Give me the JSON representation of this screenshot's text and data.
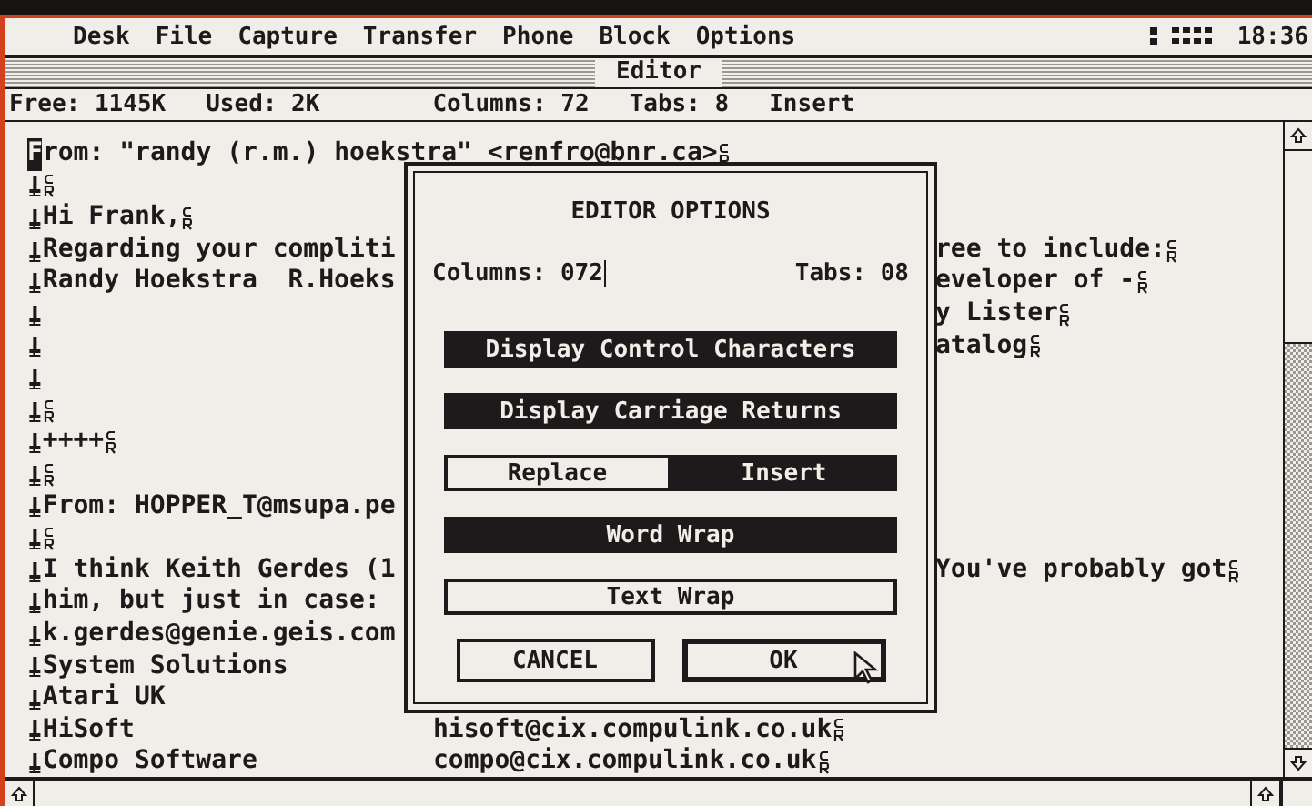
{
  "menu_bar": {
    "items": [
      "Desk",
      "File",
      "Capture",
      "Transfer",
      "Phone",
      "Block",
      "Options"
    ],
    "clock": "18:36"
  },
  "window": {
    "title": "Editor"
  },
  "status_line": {
    "free": "Free: 1145K",
    "used": "Used: 2K",
    "columns": "Columns: 72",
    "tabs": "Tabs: 8",
    "mode": "Insert"
  },
  "editor": {
    "lines": [
      {
        "cursor": "F",
        "left": "rom: \"randy (r.m.) hoekstra\" <renfro@bnr.ca>",
        "cr": true
      },
      {
        "tab": true,
        "cr": true
      },
      {
        "tab": true,
        "left": "Hi Frank,",
        "cr": true
      },
      {
        "tab": true,
        "left": "Regarding your compliti",
        "right": "ree to include:",
        "cr": true
      },
      {
        "tab": true,
        "left": "Randy Hoekstra  R.Hoeks",
        "right": "eveloper of -",
        "cr": true
      },
      {
        "tab": true,
        "right": "y Lister",
        "cr": true
      },
      {
        "tab": true,
        "right": "atalog",
        "cr": true
      },
      {
        "tab": true
      },
      {
        "tab": true,
        "cr": true
      },
      {
        "tab": true,
        "left": "++++",
        "cr": true
      },
      {
        "tab": true,
        "cr": true
      },
      {
        "tab": true,
        "left": "From: HOPPER_T@msupa.pe"
      },
      {
        "tab": true,
        "cr": true
      },
      {
        "tab": true,
        "left": "I think Keith Gerdes (1",
        "right": "You've probably got",
        "cr": true
      },
      {
        "tab": true,
        "left": "him, but just in case:"
      },
      {
        "tab": true,
        "left": "k.gerdes@genie.geis.com"
      },
      {
        "tab": true,
        "left": "System Solutions"
      },
      {
        "tab": true,
        "left": "Atari UK"
      },
      {
        "tab": true,
        "left": "HiSoft",
        "right": "hisoft@cix.compulink.co.uk",
        "cr": true
      },
      {
        "tab": true,
        "left": "Compo Software",
        "right": "compo@cix.compulink.co.uk",
        "cr": true
      }
    ]
  },
  "dialog": {
    "title": "EDITOR OPTIONS",
    "columns_label": "Columns:",
    "columns_value": "072",
    "tabs_label": "Tabs:",
    "tabs_value": "08",
    "options": [
      {
        "kind": "toggle",
        "label": "Display Control Characters",
        "selected": true
      },
      {
        "kind": "toggle",
        "label": "Display Carriage Returns",
        "selected": true
      },
      {
        "kind": "pair",
        "choices": [
          {
            "label": "Replace",
            "selected": false
          },
          {
            "label": "Insert",
            "selected": true
          }
        ]
      },
      {
        "kind": "toggle",
        "label": "Word Wrap",
        "selected": true
      },
      {
        "kind": "toggle",
        "label": "Text Wrap",
        "selected": false
      }
    ],
    "buttons": [
      {
        "label": "CANCEL",
        "default": false
      },
      {
        "label": "OK",
        "default": true
      }
    ]
  }
}
